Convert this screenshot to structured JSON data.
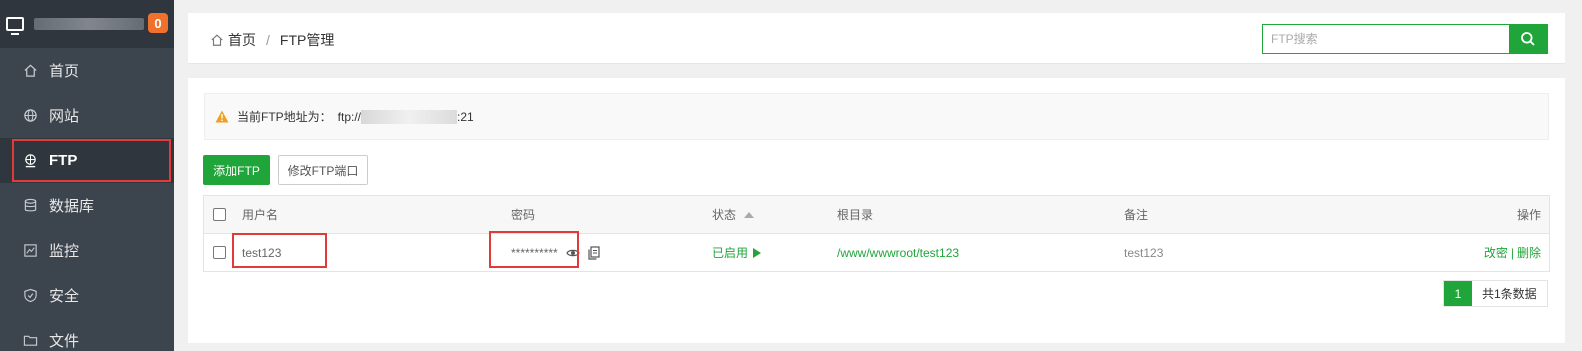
{
  "sidebar": {
    "badge_count": "0",
    "items": [
      {
        "label": "首页",
        "icon": "home-icon"
      },
      {
        "label": "网站",
        "icon": "globe-icon"
      },
      {
        "label": "FTP",
        "icon": "ftp-icon",
        "active": true
      },
      {
        "label": "数据库",
        "icon": "database-icon"
      },
      {
        "label": "监控",
        "icon": "monitor-chart-icon"
      },
      {
        "label": "安全",
        "icon": "shield-icon"
      },
      {
        "label": "文件",
        "icon": "folder-icon"
      }
    ]
  },
  "header": {
    "breadcrumb_home": "首页",
    "breadcrumb_sep": "/",
    "breadcrumb_current": "FTP管理",
    "search_placeholder": "FTP搜索"
  },
  "notice": {
    "label": "当前FTP地址为：",
    "address_prefix": "ftp://",
    "address_suffix": ":21"
  },
  "toolbar": {
    "add_label": "添加FTP",
    "port_label": "修改FTP端口"
  },
  "table": {
    "headers": {
      "username": "用户名",
      "password": "密码",
      "status": "状态",
      "root": "根目录",
      "note": "备注",
      "actions": "操作"
    },
    "rows": [
      {
        "username": "test123",
        "password": "**********",
        "status": "已启用",
        "root": "/www/wwwroot/test123",
        "note": "test123",
        "action_change_pw": "改密",
        "action_sep": "|",
        "action_delete": "删除"
      }
    ]
  },
  "pagination": {
    "current_page": "1",
    "total_text": "共1条数据"
  },
  "colors": {
    "accent": "#20a53a",
    "sidebar_bg": "#3c444d",
    "highlight": "#e03a3a",
    "badge": "#f0712c"
  }
}
